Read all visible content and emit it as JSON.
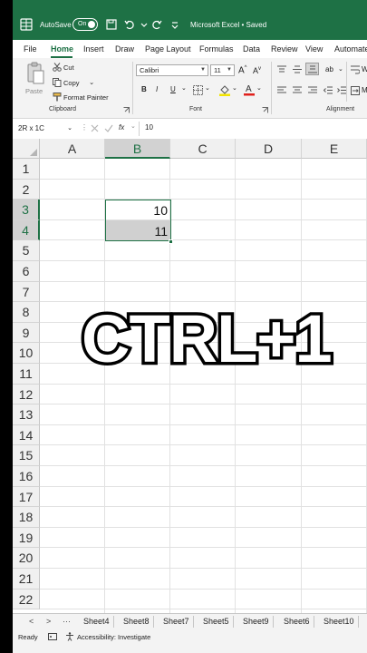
{
  "titlebar": {
    "autosave_label": "AutoSave",
    "autosave_state": "On",
    "document_title": "Microsoft Excel • Saved",
    "title_chevron": "⌄"
  },
  "menu": {
    "tabs": [
      "File",
      "Home",
      "Insert",
      "Draw",
      "Page Layout",
      "Formulas",
      "Data",
      "Review",
      "View",
      "Automate"
    ],
    "active": "Home"
  },
  "ribbon": {
    "clipboard": {
      "paste": "Paste",
      "cut": "Cut",
      "copy": "Copy",
      "format_painter": "Format Painter",
      "group_label": "Clipboard"
    },
    "font": {
      "font_name": "Calibri",
      "font_size": "11",
      "bold": "B",
      "italic": "I",
      "underline": "U",
      "group_label": "Font"
    },
    "alignment": {
      "group_label": "Alignment",
      "wrap_partial": "W",
      "merge_partial": "M"
    }
  },
  "formula_bar": {
    "name_box": "2R x 1C",
    "fx": "fx",
    "value": "10"
  },
  "grid": {
    "columns": [
      "A",
      "B",
      "C",
      "D",
      "E"
    ],
    "selected_column": "B",
    "rows": [
      "1",
      "2",
      "3",
      "4",
      "5",
      "6",
      "7",
      "8",
      "9",
      "10",
      "11",
      "12",
      "13",
      "14",
      "15",
      "16",
      "17",
      "18",
      "19",
      "20",
      "21",
      "22"
    ],
    "selected_rows": [
      "3",
      "4"
    ],
    "cells": {
      "B3": "10",
      "B4": "11"
    }
  },
  "overlay_caption": "CTRL+1",
  "sheets": {
    "nav_prev": "<",
    "nav_next": ">",
    "nav_more": "···",
    "tabs": [
      "Sheet4",
      "Sheet8",
      "Sheet7",
      "Sheet5",
      "Sheet9",
      "Sheet6",
      "Sheet10"
    ]
  },
  "status": {
    "ready": "Ready",
    "accessibility": "Accessibility: Investigate"
  },
  "colors": {
    "brand": "#1e7145",
    "selection_fill": "#d0d0d0"
  }
}
